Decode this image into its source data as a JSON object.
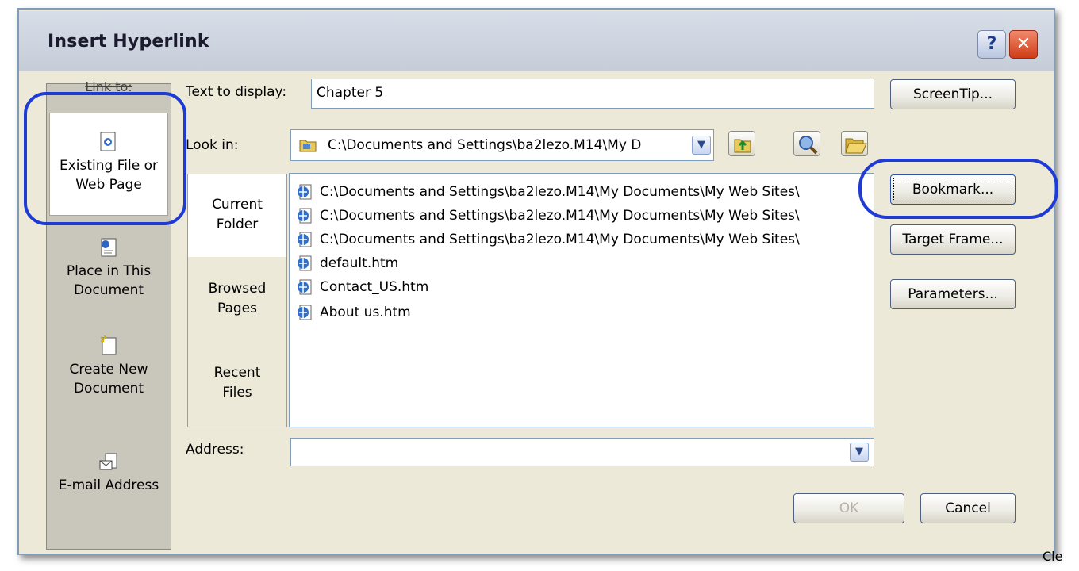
{
  "window": {
    "title": "Insert Hyperlink",
    "help_glyph": "?",
    "close_glyph": "✕"
  },
  "link_to": {
    "label": "Link to:",
    "items": [
      {
        "label_line1": "Existing File or",
        "label_line2": "Web Page",
        "icon": "existing-file-icon",
        "selected": true
      },
      {
        "label_line1": "Place in This",
        "label_line2": "Document",
        "icon": "place-in-document-icon",
        "selected": false
      },
      {
        "label_line1": "Create New",
        "label_line2": "Document",
        "icon": "new-document-icon",
        "selected": false
      },
      {
        "label_line1": "E-mail Address",
        "label_line2": "",
        "icon": "email-icon",
        "selected": false
      }
    ]
  },
  "text_to_display": {
    "label": "Text to display:",
    "value": "Chapter 5"
  },
  "look_in": {
    "label": "Look in:",
    "value": "C:\\Documents and Settings\\ba2lezo.M14\\My D"
  },
  "tabs": [
    {
      "line1": "Current",
      "line2": "Folder",
      "active": true
    },
    {
      "line1": "Browsed",
      "line2": "Pages",
      "active": false
    },
    {
      "line1": "Recent",
      "line2": "Files",
      "active": false
    }
  ],
  "files": [
    "C:\\Documents and Settings\\ba2lezo.M14\\My Documents\\My Web Sites\\",
    "C:\\Documents and Settings\\ba2lezo.M14\\My Documents\\My Web Sites\\",
    "C:\\Documents and Settings\\ba2lezo.M14\\My Documents\\My Web Sites\\",
    "default.htm",
    "Contact_US.htm",
    "About us.htm"
  ],
  "address": {
    "label": "Address:",
    "value": ""
  },
  "buttons": {
    "screentip": "ScreenTip...",
    "bookmark": "Bookmark...",
    "target_frame": "Target Frame...",
    "parameters": "Parameters...",
    "ok": "OK",
    "cancel": "Cancel"
  },
  "bottom_right_fragment": "Cle",
  "colors": {
    "highlight_oval": "#1f3bd6",
    "dialog_bg": "#ece9d8"
  }
}
